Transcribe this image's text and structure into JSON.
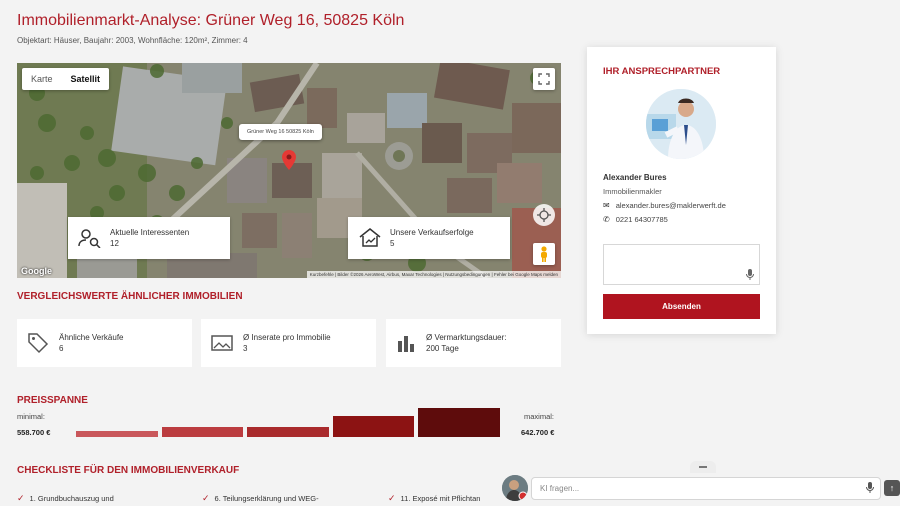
{
  "header": {
    "title": "Immobilienmarkt-Analyse: Grüner Weg 16, 50825 Köln",
    "subtitle": "Objektart: Häuser, Baujahr: 2003, Wohnfläche: 120m², Zimmer: 4"
  },
  "map": {
    "tabs": [
      {
        "label": "Karte",
        "active": false
      },
      {
        "label": "Satellit",
        "active": true
      }
    ],
    "pin_label": "Grüner Weg 16 50825 Köln",
    "interest_card": {
      "label": "Aktuelle Interessenten",
      "value": "12",
      "icon": "user-search-icon"
    },
    "success_card": {
      "label": "Unsere Verkaufserfolge",
      "value": "5",
      "icon": "house-trend-icon"
    },
    "google_logo": "Google",
    "attribution": "Kurzbefehle | Bilder ©2026 AeroWest, Airbus, Maxar Technologies | Nutzungsbedingungen | Fehler bei Google Maps melden"
  },
  "comparison": {
    "title": "VERGLEICHSWERTE ÄHNLICHER IMMOBILIEN",
    "cards": [
      {
        "label": "Ähnliche Verkäufe",
        "value": "6",
        "icon": "tag-icon"
      },
      {
        "label": "Ø Inserate pro Immobilie",
        "value": "3",
        "icon": "image-icon"
      },
      {
        "label": "Ø Vermarktungsdauer:",
        "value": "200 Tage",
        "icon": "bar-chart-icon"
      }
    ]
  },
  "price_range": {
    "title": "PREISSPANNE",
    "min_label": "minimal:",
    "min_value": "558.700 €",
    "max_label": "maximal:",
    "max_value": "642.700 €",
    "bar_levels": [
      0.15,
      0.27,
      0.27,
      0.58,
      0.78
    ],
    "bar_colors": [
      "#c9575b",
      "#bb3c3f",
      "#a92a2c",
      "#8c1313",
      "#5e0c0c"
    ]
  },
  "checklist": {
    "title": "CHECKLISTE FÜR DEN IMMOBILIENVERKAUF",
    "items": [
      "1. Grundbuchauszug und",
      "6. Teilungserklärung und WEG-",
      "11. Exposé mit Pflichtan"
    ]
  },
  "contact": {
    "title": "IHR ANSPRECHPARTNER",
    "name": "Alexander Bures",
    "role": "Immobilienmakler",
    "email": "alexander.bures@maklerwerft.de",
    "phone": "0221 64307785",
    "send_label": "Absenden"
  },
  "chat": {
    "placeholder": "KI fragen..."
  },
  "colors": {
    "accent": "#b0202a",
    "button": "#b0141f"
  }
}
